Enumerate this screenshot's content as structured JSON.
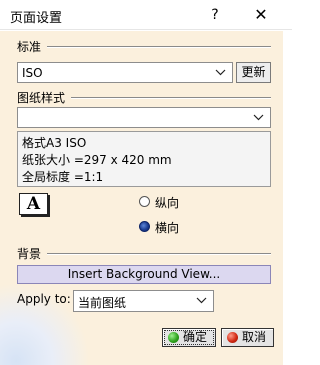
{
  "dialog": {
    "title": "页面设置",
    "help_label": "?",
    "close_label": "✕"
  },
  "standard": {
    "section_label": "标准",
    "selected": "ISO",
    "update_button": "更新"
  },
  "sheet_style": {
    "section_label": "图纸样式",
    "selected": "",
    "info": {
      "format": "格式A3 ISO",
      "paper_size": "纸张大小 =297 x 420 mm",
      "scale": "全局标度 =1:1"
    }
  },
  "orientation": {
    "icon_glyph": "A",
    "options": [
      {
        "label": "纵向",
        "checked": false
      },
      {
        "label": "横向",
        "checked": true
      }
    ]
  },
  "background": {
    "section_label": "背景",
    "insert_button": "Insert Background View...",
    "apply_to_label": "Apply to:",
    "apply_to_value": "当前图纸"
  },
  "footer": {
    "ok_button": "确定",
    "cancel_button": "取消"
  },
  "colors": {
    "dialog_background": "#fbf0dd",
    "insert_button_background": "#dcd8f0",
    "ok_icon": "#2fa41e",
    "cancel_icon": "#d22a14",
    "selected_radio": "#1c3e93"
  },
  "icons": {
    "orientation": "letter-a-page-icon",
    "chevron": "chevron-down-icon",
    "ok": "green-dot-icon",
    "cancel": "red-dot-icon"
  }
}
